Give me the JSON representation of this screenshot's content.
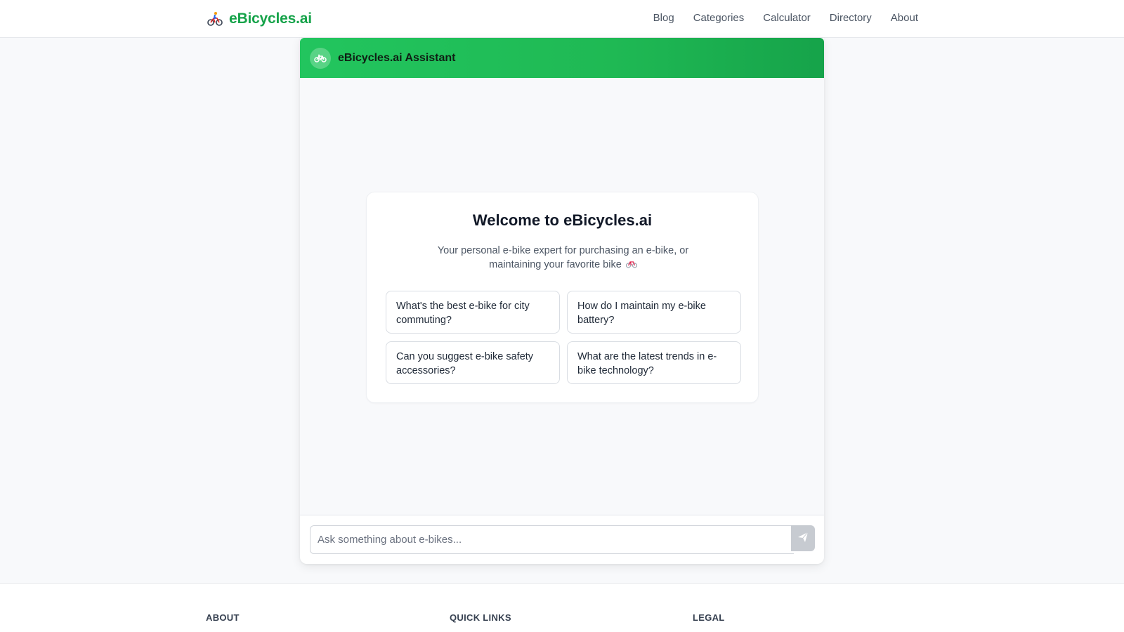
{
  "header": {
    "brand": "eBicycles.ai",
    "brand_icon": "bicyclist-icon",
    "nav": [
      "Blog",
      "Categories",
      "Calculator",
      "Directory",
      "About"
    ]
  },
  "chat": {
    "title": "eBicycles.ai Assistant",
    "avatar_icon": "bicycle-icon",
    "accent_color": "#22c55e",
    "welcome": {
      "heading": "Welcome to eBicycles.ai",
      "subtitle": "Your personal e-bike expert for purchasing an e-bike, or maintaining your favorite bike",
      "subtitle_icon": "bicycle-icon"
    },
    "suggestions": [
      "What's the best e-bike for city commuting?",
      "How do I maintain my e-bike battery?",
      "Can you suggest e-bike safety accessories?",
      "What are the latest trends in e-bike technology?"
    ],
    "input": {
      "placeholder": "Ask something about e-bikes...",
      "value": ""
    },
    "send_icon": "send-icon"
  },
  "footer": {
    "columns": [
      "ABOUT",
      "QUICK LINKS",
      "LEGAL"
    ]
  }
}
